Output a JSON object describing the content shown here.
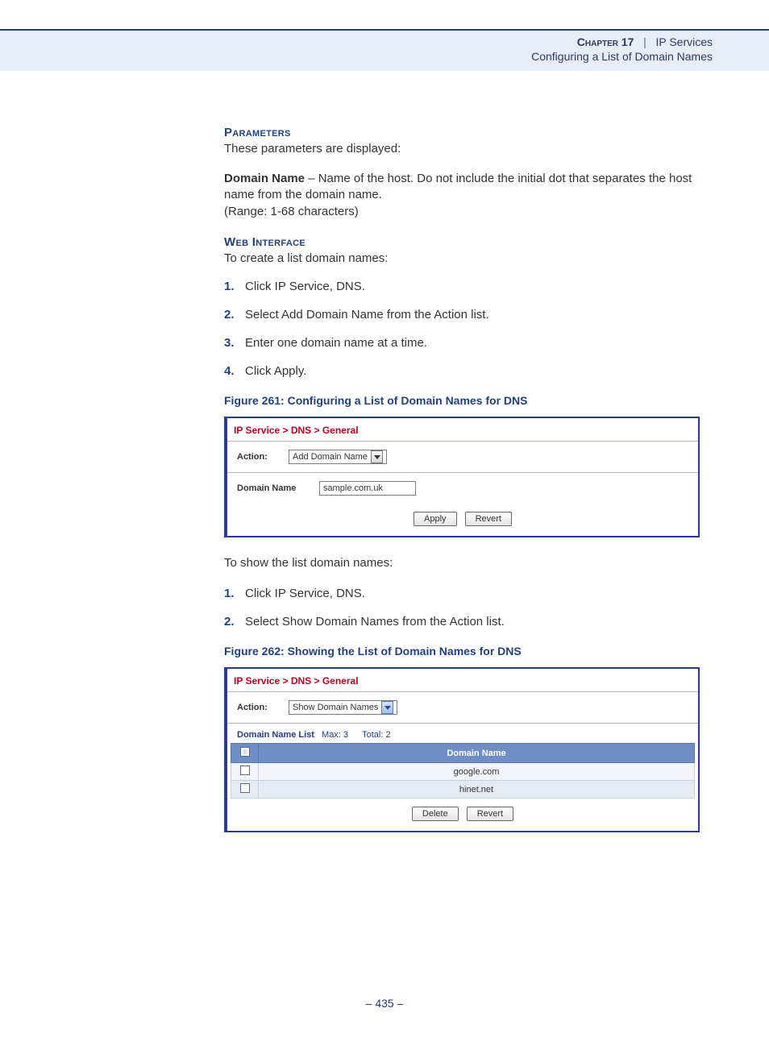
{
  "header": {
    "chapter_label": "Chapter 17",
    "pipe": "|",
    "title": "IP Services",
    "subtitle": "Configuring a List of Domain Names"
  },
  "sections": {
    "parameters_head": "Parameters",
    "parameters_intro": "These parameters are displayed:",
    "domain_name_label": "Domain Name",
    "domain_name_desc": " – Name of the host. Do not include the initial dot that separates the host name from the domain name.",
    "domain_name_range": "(Range: 1-68 characters)",
    "web_interface_head": "Web Interface",
    "create_intro": "To create a list domain names:",
    "create_steps": [
      "Click IP Service, DNS.",
      "Select Add Domain Name from the Action list.",
      "Enter one domain name at a time.",
      "Click Apply."
    ],
    "fig261_caption": "Figure 261:  Configuring a List of Domain Names for DNS",
    "show_intro": "To show the list domain names:",
    "show_steps": [
      "Click IP Service, DNS.",
      "Select Show Domain Names from the Action list."
    ],
    "fig262_caption": "Figure 262:  Showing the List of Domain Names for DNS"
  },
  "fig261": {
    "breadcrumb": "IP Service > DNS > General",
    "action_label": "Action:",
    "action_value": "Add Domain Name",
    "field_label": "Domain Name",
    "field_value": "sample.com.uk",
    "apply": "Apply",
    "revert": "Revert"
  },
  "fig262": {
    "breadcrumb": "IP Service > DNS > General",
    "action_label": "Action:",
    "action_value": "Show Domain Names",
    "list_title": "Domain Name List",
    "max_label": "Max: 3",
    "total_label": "Total: 2",
    "col_header": "Domain Name",
    "rows": [
      "google.com",
      "hinet.net"
    ],
    "delete": "Delete",
    "revert": "Revert"
  },
  "footer": {
    "page": "–  435  –"
  }
}
